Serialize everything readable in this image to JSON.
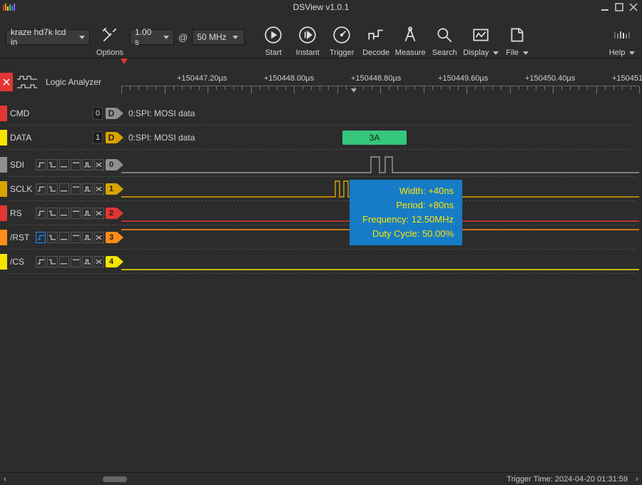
{
  "title": "DSView v1.0.1",
  "device": {
    "name": "kraze hd7k lcd in",
    "timebase": "1.00 s",
    "samplerate": "50 MHz"
  },
  "toolbar": {
    "options": "Options",
    "start": "Start",
    "instant": "Instant",
    "trigger": "Trigger",
    "decode": "Decode",
    "measure": "Measure",
    "search": "Search",
    "display": "Display",
    "file": "File",
    "help": "Help"
  },
  "tab": {
    "label": "Logic Analyzer"
  },
  "time_labels": [
    "+150447.20µs",
    "+150448.00µs",
    "+150448.80µs",
    "+150449.60µs",
    "+150450.40µs",
    "+150451."
  ],
  "decoders": [
    {
      "num": "0",
      "label": "0:SPI: MOSI data"
    },
    {
      "num": "1",
      "label": "0:SPI: MOSI data"
    }
  ],
  "decode_value": "3A",
  "channels": [
    {
      "name": "SDI",
      "num": "0",
      "color": "#8f8f8f"
    },
    {
      "name": "SCLK",
      "num": "1",
      "color": "#d9a400"
    },
    {
      "name": "RS",
      "num": "2",
      "color": "#e03636"
    },
    {
      "name": "/RST",
      "num": "3",
      "color": "#ff8c1a"
    },
    {
      "name": "/CS",
      "num": "4",
      "color": "#f5e400"
    }
  ],
  "measure": {
    "width_k": "Width:",
    "width_v": "+40ns",
    "period_k": "Period:",
    "period_v": "+80ns",
    "freq_k": "Frequency:",
    "freq_v": "12.50MHz",
    "duty_k": "Duty Cycle:",
    "duty_v": "50.00%"
  },
  "status": {
    "trigger": "Trigger Time: 2024-04-20 01:31:59"
  }
}
